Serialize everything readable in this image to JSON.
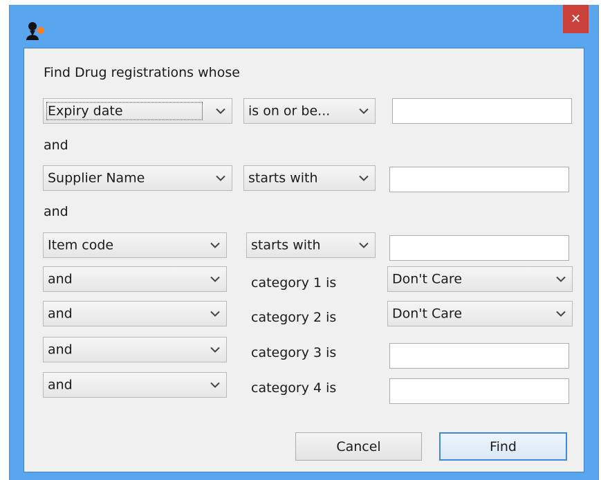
{
  "window": {
    "close_glyph": "✕",
    "app_icon": "mSupply-user-icon",
    "accent": "#5aa6ee"
  },
  "dialog": {
    "heading": "Find Drug registrations whose",
    "row1": {
      "field": "Expiry date",
      "operator": "is on or be...",
      "value": ""
    },
    "join1": "and",
    "row2": {
      "field": "Supplier Name",
      "operator": "starts with",
      "value": ""
    },
    "join2": "and",
    "row3": {
      "field": "Item code",
      "operator": "starts with",
      "value": ""
    },
    "categories": [
      {
        "connector": "and",
        "label": "category 1 is",
        "value": "Don't Care"
      },
      {
        "connector": "and",
        "label": "category 2 is",
        "value": "Don't Care"
      },
      {
        "connector": "and",
        "label": "category 3 is",
        "value": ""
      },
      {
        "connector": "and",
        "label": "category 4 is",
        "value": ""
      }
    ],
    "buttons": {
      "cancel": "Cancel",
      "find": "Find"
    }
  }
}
